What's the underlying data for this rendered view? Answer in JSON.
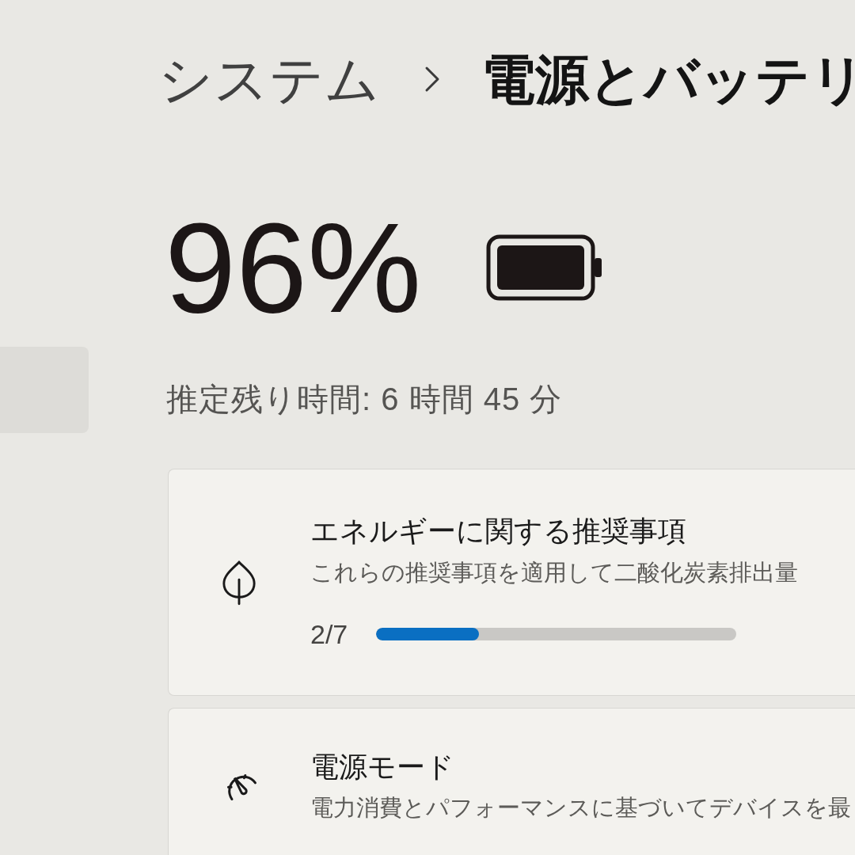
{
  "sidebar": {
    "items": [
      {
        "selected": true
      }
    ]
  },
  "breadcrumb": {
    "parent": "システム",
    "current": "電源とバッテリ"
  },
  "battery": {
    "percent": "96%",
    "estimate": "推定残り時間: 6 時間 45 分"
  },
  "cards": [
    {
      "kind": "progress",
      "title": "エネルギーに関する推奨事項",
      "description": "これらの推奨事項を適用して二酸化炭素排出量",
      "progress": {
        "label": "2/7",
        "level": 0.286
      }
    },
    {
      "kind": "plain",
      "title": "電源モード",
      "description": "電力消費とパフォーマンスに基づいてデバイスを最"
    }
  ]
}
